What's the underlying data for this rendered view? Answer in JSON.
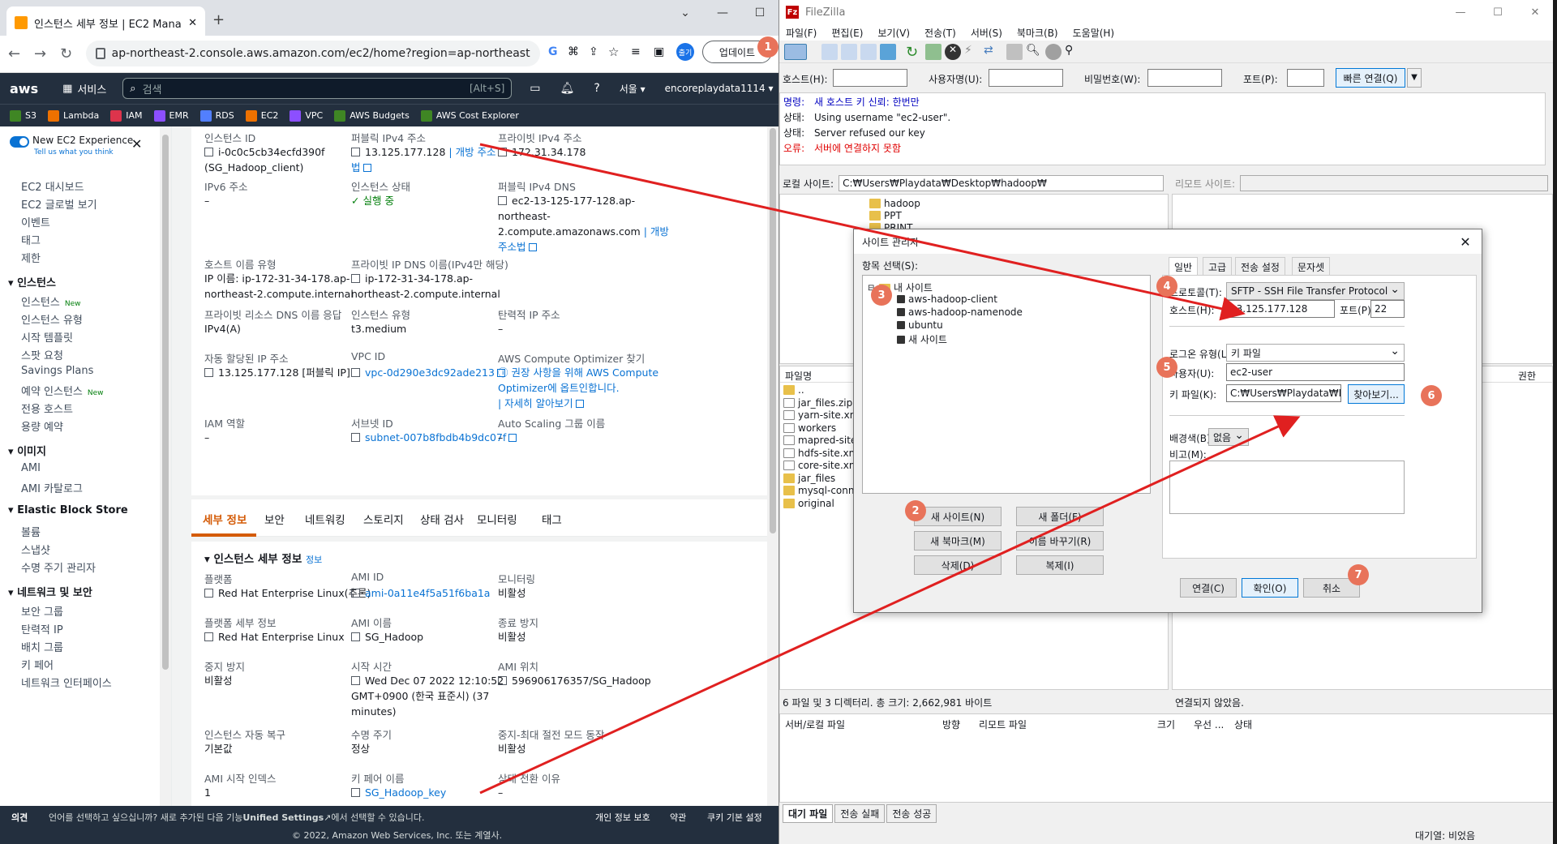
{
  "chrome": {
    "tab_title": "인스턴스 세부 정보 | EC2 Mana",
    "url": "ap-northeast-2.console.aws.amazon.com/ec2/home?region=ap-northeast-2...",
    "update_button": "업데이트",
    "profile_label": "출기"
  },
  "aws_nav": {
    "logo": "aws",
    "services": "서비스",
    "search_placeholder": "검색",
    "search_shortcut": "[Alt+S]",
    "region": "서울 ▾",
    "account": "encoreplaydata1114 ▾"
  },
  "favorites": [
    "S3",
    "Lambda",
    "IAM",
    "EMR",
    "RDS",
    "EC2",
    "VPC",
    "AWS Budgets",
    "AWS Cost Explorer"
  ],
  "favorite_colors": [
    "#3f8624",
    "#ed7100",
    "#dd344c",
    "#8c4fff",
    "#527fff",
    "#ed7100",
    "#8c4fff",
    "#3f8624",
    "#3f8624"
  ],
  "sidebar": {
    "new_exp_title": "New EC2 Experience",
    "new_exp_sub": "Tell us what you think",
    "new_badge": "New",
    "items_top": [
      "EC2 대시보드",
      "EC2 글로벌 보기",
      "이벤트",
      "태그",
      "제한"
    ],
    "section_instances": "인스턴스",
    "instances_items": [
      "인스턴스",
      "인스턴스 유형",
      "시작 템플릿",
      "스팟 요청",
      "Savings Plans",
      "예약 인스턴스",
      "전용 호스트",
      "용량 예약"
    ],
    "section_images": "이미지",
    "images_items": [
      "AMI",
      "AMI 카탈로그"
    ],
    "section_ebs": "Elastic Block Store",
    "ebs_items": [
      "볼륨",
      "스냅샷",
      "수명 주기 관리자"
    ],
    "section_network": "네트워크 및 보안",
    "network_items": [
      "보안 그룹",
      "탄력적 IP",
      "배치 그룹",
      "키 페어",
      "네트워크 인터페이스"
    ]
  },
  "summary": {
    "instance_id_label": "인스턴스 ID",
    "instance_id_value": "i-0c0c5cb34ecfd390f",
    "instance_id_name": "(SG_Hadoop_client)",
    "public_ipv4_label": "퍼블릭 IPv4 주소",
    "public_ipv4_value": "13.125.177.128",
    "open_address": "| 개방 주소",
    "open_address_2": "법",
    "private_ipv4_label": "프라이빗 IPv4 주소",
    "private_ipv4_value": "172.31.34.178",
    "ipv6_label": "IPv6 주소",
    "ipv6_value": "–",
    "state_label": "인스턴스 상태",
    "state_value": "실행 중",
    "public_dns_label": "퍼블릭 IPv4 DNS",
    "public_dns_value_1": "ec2-13-125-177-128.ap-",
    "public_dns_value_2": "northeast-",
    "public_dns_value_3": "2.compute.amazonaws.com",
    "public_dns_open": "| 개방",
    "public_dns_open_2": "주소법",
    "hostname_type_label": "호스트 이름 유형",
    "hostname_type_value_1": "IP 이름: ip-172-31-34-178.ap-",
    "hostname_type_value_2": "northeast-2.compute.internal",
    "private_dns_label": "프라이빗 IP DNS 이름(IPv4만 해당)",
    "private_dns_value_1": "ip-172-31-34-178.ap-",
    "private_dns_value_2": "northeast-2.compute.internal",
    "private_resource_label": "프라이빗 리소스 DNS 이름 응답",
    "private_resource_value": "IPv4(A)",
    "instance_type_label": "인스턴스 유형",
    "instance_type_value": "t3.medium",
    "elastic_ip_label": "탄력적 IP 주소",
    "elastic_ip_value": "–",
    "auto_ip_label": "자동 할당된 IP 주소",
    "auto_ip_value": "13.125.177.128 [퍼블릭 IP]",
    "vpc_label": "VPC ID",
    "vpc_value": "vpc-0d290e3dc92ade213",
    "optimizer_label": "AWS Compute Optimizer 찾기",
    "optimizer_value_1": "권장 사항을 위해 AWS Compute",
    "optimizer_value_2": "Optimizer에 옵트인합니다.",
    "optimizer_more": "| 자세히 알아보기",
    "iam_label": "IAM 역할",
    "iam_value": "–",
    "subnet_label": "서브넷 ID",
    "subnet_value": "subnet-007b8fbdb4b9dc07f",
    "asg_label": "Auto Scaling 그룹 이름",
    "asg_value": "–"
  },
  "detail_tabs": [
    "세부 정보",
    "보안",
    "네트워킹",
    "스토리지",
    "상태 검사",
    "모니터링",
    "태그"
  ],
  "details": {
    "section_title": "인스턴스 세부 정보",
    "section_info": "정보",
    "platform_label": "플랫폼",
    "platform_value": "Red Hat Enterprise Linux(추론)",
    "ami_id_label": "AMI ID",
    "ami_id_value": "ami-0a11e4f5a51f6ba1a",
    "monitoring_label": "모니터링",
    "monitoring_value": "비활성",
    "platform_detail_label": "플랫폼 세부 정보",
    "platform_detail_value": "Red Hat Enterprise Linux",
    "ami_name_label": "AMI 이름",
    "ami_name_value": "SG_Hadoop",
    "termination_label": "종료 방지",
    "termination_value": "비활성",
    "stop_protect_label": "중지 방지",
    "stop_protect_value": "비활성",
    "launch_time_label": "시작 시간",
    "launch_time_value_1": "Wed Dec 07 2022 12:10:52",
    "launch_time_value_2": "GMT+0900 (한국 표준시) (37",
    "launch_time_value_3": "minutes)",
    "ami_location_label": "AMI 위치",
    "ami_location_value": "596906176357/SG_Hadoop",
    "auto_recovery_label": "인스턴스 자동 복구",
    "auto_recovery_value": "기본값",
    "lifecycle_label": "수명 주기",
    "lifecycle_value": "정상",
    "stop_hibernate_label": "중지-최대 절전 모드 동작",
    "stop_hibernate_value": "비활성",
    "ami_launch_index_label": "AMI 시작 인덱스",
    "ami_launch_index_value": "1",
    "key_pair_label": "키 페어 이름",
    "key_pair_value": "SG_Hadoop_key",
    "state_reason_label": "상태 전환 이유",
    "state_reason_value": "–"
  },
  "footer": {
    "feedback": "의견",
    "language_note": "언어를 선택하고 싶으십니까? 새로 추가된 다음 기능",
    "unified_settings": "Unified Settings",
    "language_note_2": "에서 선택할 수 있습니다.",
    "privacy": "개인 정보 보호",
    "terms": "약관",
    "cookies": "쿠키 기본 설정",
    "copyright": "© 2022, Amazon Web Services, Inc. 또는 계열사."
  },
  "filezilla": {
    "title": "FileZilla",
    "menu": [
      "파일(F)",
      "편집(E)",
      "보기(V)",
      "전송(T)",
      "서버(S)",
      "북마크(B)",
      "도움말(H)"
    ],
    "qc_host_label": "호스트(H):",
    "qc_user_label": "사용자명(U):",
    "qc_pass_label": "비밀번호(W):",
    "qc_port_label": "포트(P):",
    "qc_connect": "빠른 연결(Q)",
    "log": [
      {
        "kind": "명령:",
        "text": "새 호스트 키 신뢰: 한번만",
        "color": "#0000c0"
      },
      {
        "kind": "상태:",
        "text": "Using username \"ec2-user\".",
        "color": "#000000"
      },
      {
        "kind": "상태:",
        "text": "Server refused our key",
        "color": "#000000"
      },
      {
        "kind": "오류:",
        "text": "서버에 연결하지 못함",
        "color": "#e00000"
      }
    ],
    "local_site_label": "로컬 사이트:",
    "local_site_path": "C:₩Users₩Playdata₩Desktop₩hadoop₩",
    "remote_site_label": "리모트 사이트:",
    "local_tree": [
      "hadoop",
      "PPT",
      "PRINT"
    ],
    "local_files_header": "파일명",
    "local_files": [
      "..",
      "jar_files.zip",
      "yarn-site.xml",
      "workers",
      "mapred-site.",
      "hdfs-site.xml",
      "core-site.xml",
      "jar_files",
      "mysql-conne",
      "original"
    ],
    "remote_perm_header": "권한",
    "local_status": "6 파일 및 3 디렉터리. 총 크기: 2,662,981 바이트",
    "remote_status": "연결되지 않았음.",
    "queue_headers": [
      "서버/로컬 파일",
      "방향",
      "리모트 파일",
      "크기",
      "우선 ...",
      "상태"
    ],
    "queue_tabs": [
      "대기 파일",
      "전송 실패",
      "전송 성공"
    ],
    "queue_status": "대기열: 비었음"
  },
  "site_manager": {
    "title": "사이트 관리자",
    "select_label": "항목 선택(S):",
    "root": "내 사이트",
    "sites": [
      "aws-hadoop-client",
      "aws-hadoop-namenode",
      "ubuntu",
      "새 사이트"
    ],
    "tabs": [
      "일반",
      "고급",
      "전송 설정",
      "문자셋"
    ],
    "protocol_label": "프로토콜(T):",
    "protocol_value": "SFTP - SSH File Transfer Protocol",
    "host_label": "호스트(H):",
    "host_value": "13.125.177.128",
    "port_label": "포트(P):",
    "port_value": "22",
    "logon_label": "로그온 유형(L):",
    "logon_value": "키 파일",
    "user_label": "사용자(U):",
    "user_value": "ec2-user",
    "keyfile_label": "키 파일(K):",
    "keyfile_value": "C:₩Users₩Playdata₩Download",
    "browse": "찾아보기...",
    "bg_label": "배경색(B):",
    "bg_value": "없음",
    "comments_label": "비고(M):",
    "btn_new_site": "새 사이트(N)",
    "btn_new_folder": "새 폴더(F)",
    "btn_new_bookmark": "새 북마크(M)",
    "btn_rename": "이름 바꾸기(R)",
    "btn_delete": "삭제(D)",
    "btn_copy": "복제(I)",
    "btn_connect": "연결(C)",
    "btn_ok": "확인(O)",
    "btn_cancel": "취소"
  },
  "badges": [
    "1",
    "2",
    "3",
    "4",
    "5",
    "6",
    "7"
  ],
  "colors": {
    "aws_nav": "#232f3e",
    "link": "#0972d3",
    "active_tab": "#d45b07",
    "badge": "#e8735a",
    "arrow": "#e02020"
  }
}
